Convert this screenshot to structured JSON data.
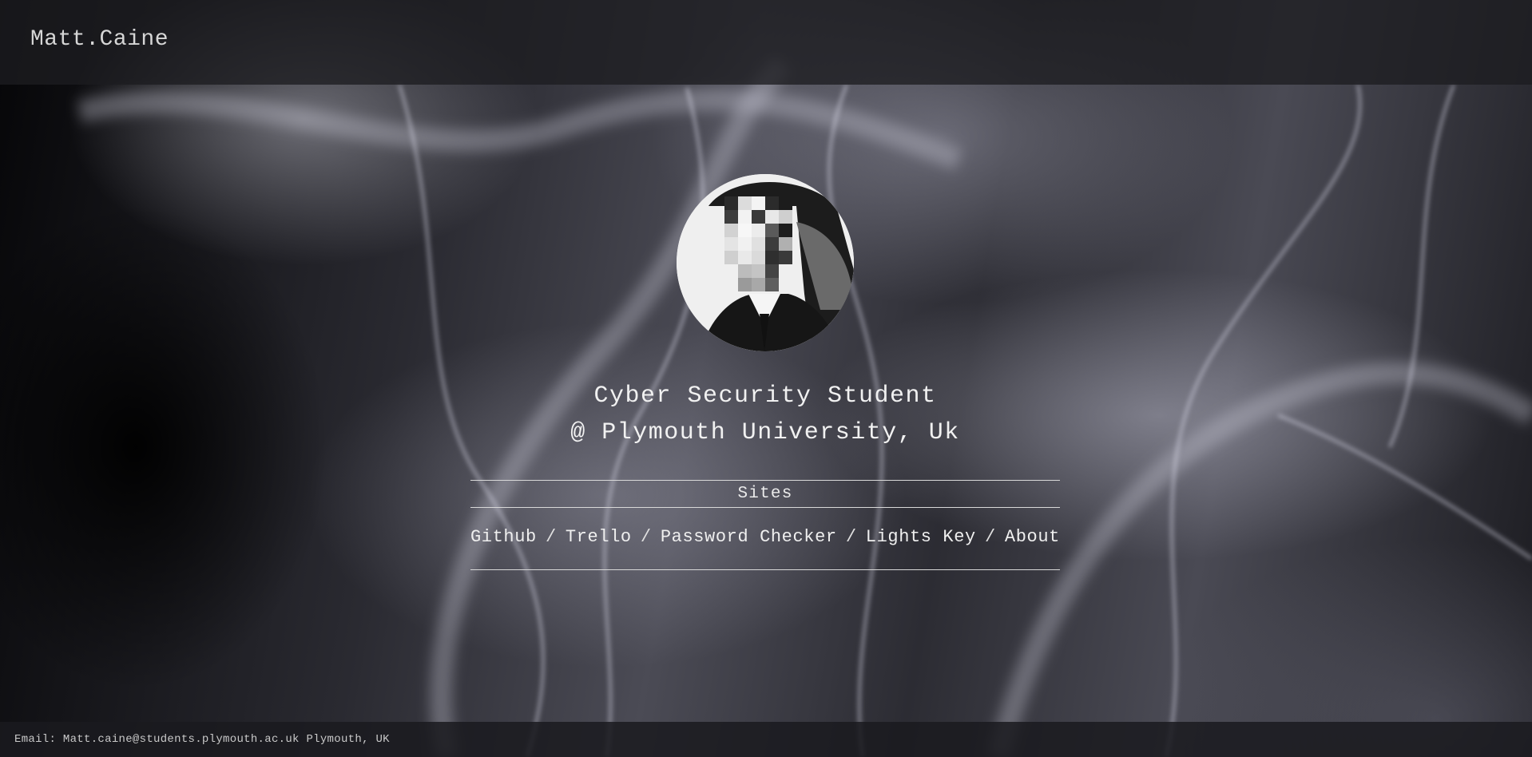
{
  "header": {
    "brand": "Matt.Caine"
  },
  "profile": {
    "avatar_icon": "pixelated-portrait-icon",
    "title_line1": "Cyber Security Student",
    "title_line2": "@ Plymouth University, Uk"
  },
  "sites": {
    "heading": "Sites",
    "links": [
      "Github",
      "Trello",
      "Password Checker",
      "Lights Key",
      "About"
    ],
    "separator": "/"
  },
  "footer": {
    "text": "Email: Matt.caine@students.plymouth.ac.uk Plymouth, UK"
  }
}
